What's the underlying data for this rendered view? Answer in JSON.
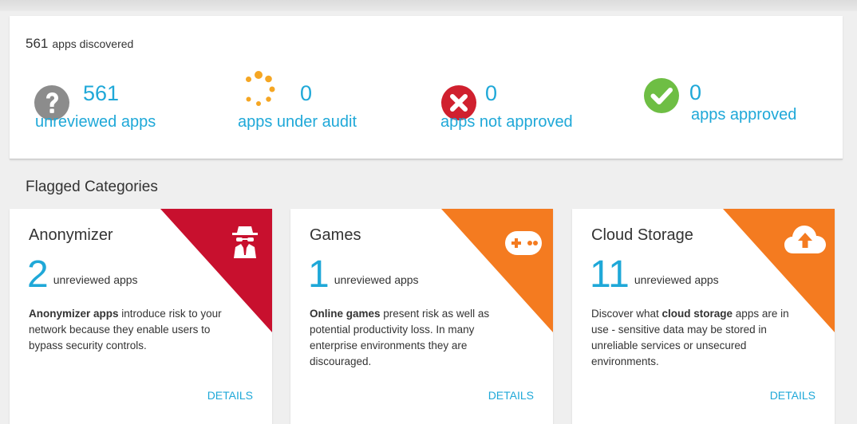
{
  "summary": {
    "total_count": "561",
    "total_label": "apps discovered",
    "stats": [
      {
        "count": "561",
        "label": "unreviewed apps",
        "icon": "question-icon",
        "color": "#8c8c8c"
      },
      {
        "count": "0",
        "label": "apps under audit",
        "icon": "spinner-dots-icon",
        "color": "#f5a623"
      },
      {
        "count": "0",
        "label": "apps not approved",
        "icon": "x-circle-icon",
        "color": "#d0202e"
      },
      {
        "count": "0",
        "label": "apps approved",
        "icon": "check-circle-icon",
        "color": "#6ebe44"
      }
    ]
  },
  "flagged": {
    "title": "Flagged Categories",
    "categories": [
      {
        "name": "Anonymizer",
        "count": "2",
        "unreviewed_label": "unreviewed apps",
        "desc_bold": "Anonymizer apps",
        "desc_rest": " introduce risk to your network because they enable users to bypass security controls.",
        "details_label": "DETAILS",
        "icon": "spy-icon",
        "corner_color": "#c8102e"
      },
      {
        "name": "Games",
        "count": "1",
        "unreviewed_label": "unreviewed apps",
        "desc_bold": "Online games",
        "desc_rest": " present risk as well as potential productivity loss. In many enterprise environments they are discouraged.",
        "details_label": "DETAILS",
        "icon": "gamepad-icon",
        "corner_color": "#f47b20"
      },
      {
        "name": "Cloud Storage",
        "count": "11",
        "unreviewed_label": "unreviewed apps",
        "desc_pre": "Discover what ",
        "desc_bold": "cloud storage",
        "desc_rest": " apps are in use - sensitive data may be stored in unreliable services or unsecured environments.",
        "details_label": "DETAILS",
        "icon": "cloud-upload-icon",
        "corner_color": "#f47b20"
      }
    ]
  }
}
